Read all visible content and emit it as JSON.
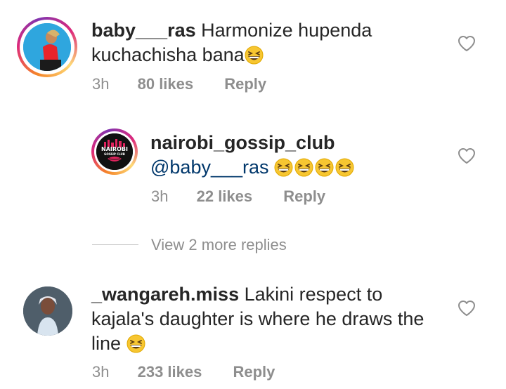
{
  "comments": [
    {
      "username": "baby___ras",
      "text": "Harmonize hupenda kuchachisha bana",
      "time": "3h",
      "likes": "80 likes",
      "reply": "Reply"
    },
    {
      "username": "nairobi_gossip_club",
      "mention": "@baby___ras",
      "avatar_text_top": "NAIROBI",
      "avatar_text_bottom": "GOSSIP CLUB",
      "time": "3h",
      "likes": "22 likes",
      "reply": "Reply"
    },
    {
      "username": "_wangareh.miss",
      "text_line1": "Lakini respect to",
      "text_line2": "kajala's daughter is where he draws the",
      "text_line3": "line",
      "time": "3h",
      "likes": "233 likes",
      "reply": "Reply"
    }
  ],
  "view_replies": "View 2 more replies",
  "icons": {
    "like": "heart-outline-icon",
    "emoji": "grinning-squinting-face-emoji"
  },
  "colors": {
    "text": "#262626",
    "meta": "#8e8e8e",
    "mention": "#00376b",
    "emoji": "#f7c631"
  }
}
